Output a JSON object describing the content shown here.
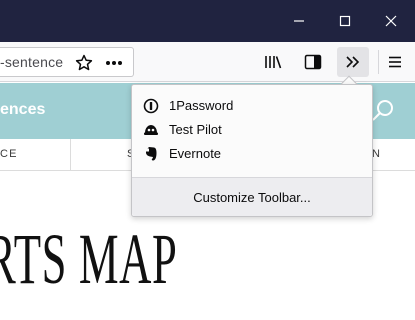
{
  "window": {
    "minimize_icon": "minimize-icon",
    "maximize_icon": "maximize-icon",
    "close_icon": "close-icon"
  },
  "toolbar": {
    "url_text": "-sentence",
    "icons": [
      "bookmark-star-icon",
      "page-actions-icon",
      "library-icon",
      "sidebar-icon",
      "overflow-chevron-icon",
      "hamburger-menu-icon"
    ]
  },
  "page": {
    "site_title": "ences",
    "nav_items": [
      "CE",
      "S",
      "N"
    ],
    "headline": "RTS MAP"
  },
  "overflow_panel": {
    "items": [
      {
        "label": "1Password",
        "icon": "onepassword-icon"
      },
      {
        "label": "Test Pilot",
        "icon": "test-pilot-icon"
      },
      {
        "label": "Evernote",
        "icon": "evernote-icon"
      }
    ],
    "footer_label": "Customize Toolbar..."
  },
  "colors": {
    "titlebar": "#202340",
    "toolbar": "#f9f9fa",
    "site_header": "#9fcfd3",
    "panel_footer": "#ededf0"
  }
}
